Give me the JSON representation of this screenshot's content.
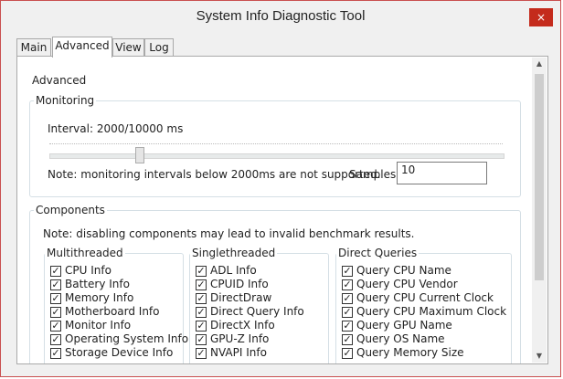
{
  "window": {
    "title": "System Info Diagnostic Tool",
    "close_glyph": "×"
  },
  "tabs": [
    {
      "label": "Main"
    },
    {
      "label": "Advanced"
    },
    {
      "label": "View"
    },
    {
      "label": "Log"
    }
  ],
  "advanced": {
    "heading": "Advanced",
    "monitoring": {
      "title": "Monitoring",
      "interval_label": "Interval: 2000/10000 ms",
      "interval_value": 2000,
      "interval_max": 10000,
      "note": "Note: monitoring intervals below 2000ms are not supported.",
      "samples_label": "Samples:",
      "samples_value": "10"
    },
    "components": {
      "title": "Components",
      "note": "Note: disabling components may lead to invalid benchmark results.",
      "multithreaded": {
        "title": "Multithreaded",
        "items": [
          "CPU Info",
          "Battery Info",
          "Memory Info",
          "Motherboard Info",
          "Monitor Info",
          "Operating System Info",
          "Storage Device Info"
        ]
      },
      "singlethreaded": {
        "title": "Singlethreaded",
        "items": [
          "ADL Info",
          "CPUID Info",
          "DirectDraw",
          "Direct Query Info",
          "DirectX Info",
          "GPU-Z Info",
          "NVAPI Info"
        ]
      },
      "direct_queries": {
        "title": "Direct Queries",
        "items": [
          "Query CPU Name",
          "Query CPU Vendor",
          "Query CPU Current Clock",
          "Query CPU Maximum Clock",
          "Query GPU Name",
          "Query OS Name",
          "Query Memory Size"
        ]
      }
    }
  },
  "check_glyph": "✓"
}
